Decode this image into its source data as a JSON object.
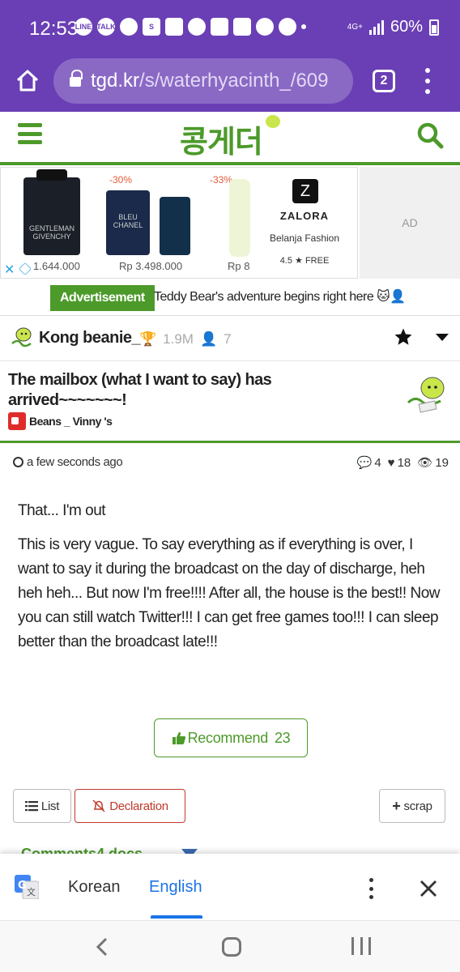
{
  "status": {
    "time": "12:53",
    "network": "4G+",
    "battery": "60%",
    "app_icons": [
      "LINE",
      "TALK",
      "",
      "S",
      "",
      "",
      "",
      "",
      "",
      "",
      ""
    ]
  },
  "browser": {
    "url_host": "tgd.kr",
    "url_path": "/s/waterhyacinth_/609",
    "tab_count": "2"
  },
  "site": {
    "logo": "콩게더"
  },
  "ad": {
    "discount1": "-30%",
    "discount2": "-33%",
    "brand1_label": "GENTLEMAN\nGIVENCHY",
    "brand2_label": "BLEU\nCHANEL",
    "price1": "1.644.000",
    "price2": "Rp 3.498.000",
    "price3": "Rp 8",
    "zalora_name": "ZALORA",
    "zalora_sub": "Belanja Fashion",
    "zalora_rating": "4.5 ★ FREE",
    "tag": "AD"
  },
  "adv_banner": {
    "label": "Advertisement",
    "text": "Teddy Bear's adventure begins right here 🐱👤"
  },
  "author": {
    "name": "Kong beanie_",
    "points": "1.9M",
    "count": "7"
  },
  "post": {
    "title": "The mailbox (what I want to say) has arrived~~~~~~~!",
    "channel": "Beans _ Vinny 's",
    "time": "a few seconds ago",
    "comments": "4",
    "likes": "18",
    "views": "19",
    "paragraphs": [
      "That... I'm out",
      "This is very vague. To say everything as if everything is over, I want to say it during the broadcast on the day of discharge, heh heh heh... But now I'm free!!!! After all, the house is the best!! Now you can still watch Twitter!!! I can get free games too!!! I can sleep better than the broadcast late!!!"
    ],
    "recommend_label": "Recommend",
    "recommend_count": "23"
  },
  "actions": {
    "list": "List",
    "declaration": "Declaration",
    "scrap": "scrap"
  },
  "comments_hint": "Comments4 docs",
  "translate": {
    "source": "Korean",
    "target": "English"
  },
  "colors": {
    "purple": "#6a3fb5",
    "green": "#4c9a2a",
    "blue": "#1a73e8",
    "red": "#c0392b"
  }
}
